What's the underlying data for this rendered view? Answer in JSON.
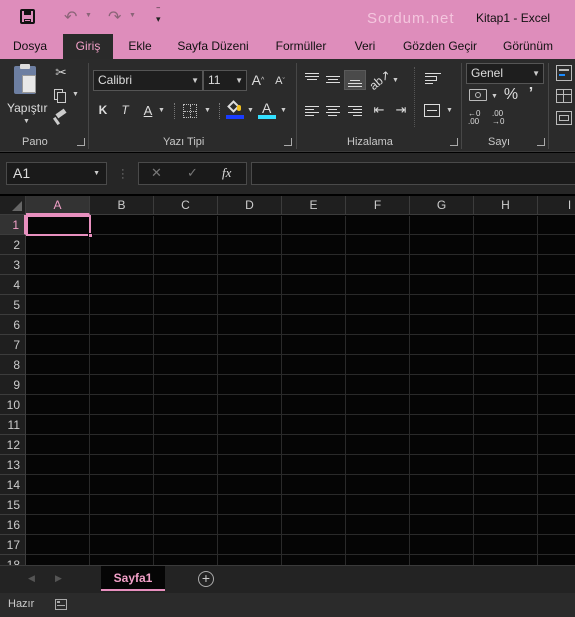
{
  "titlebar": {
    "watermark": "Sordum.net",
    "title": "Kitap1 - Excel"
  },
  "tabs": [
    "Dosya",
    "Giriş",
    "Ekle",
    "Sayfa Düzeni",
    "Formüller",
    "Veri",
    "Gözden Geçir",
    "Görünüm"
  ],
  "active_tab": "Giriş",
  "ribbon": {
    "paste_label": "Yapıştır",
    "groups": {
      "pano": "Pano",
      "font": "Yazı Tipi",
      "align": "Hizalama",
      "number": "Sayı"
    },
    "font_name": "Calibri",
    "font_size": "11",
    "bold": "K",
    "italic": "T",
    "underline": "A",
    "font_color_letter": "A",
    "number_format": "Genel",
    "percent": "%",
    "comma": "’",
    "dec_inc": "←0\n.00",
    "dec_dec": ".00\n→0"
  },
  "formula_bar": {
    "name_box": "A1",
    "fx": "fx",
    "cancel": "✕",
    "enter": "✓",
    "value": ""
  },
  "columns": [
    "A",
    "B",
    "C",
    "D",
    "E",
    "F",
    "G",
    "H",
    "I"
  ],
  "rows": [
    "1",
    "2",
    "3",
    "4",
    "5",
    "6",
    "7",
    "8",
    "9",
    "10",
    "11",
    "12",
    "13",
    "14",
    "15",
    "16",
    "17",
    "18"
  ],
  "sheets": [
    "Sayfa1"
  ],
  "status": {
    "ready": "Hazır"
  },
  "colors": {
    "accent": "#de8dbb",
    "active_tab_text": "#f2a0c8"
  }
}
